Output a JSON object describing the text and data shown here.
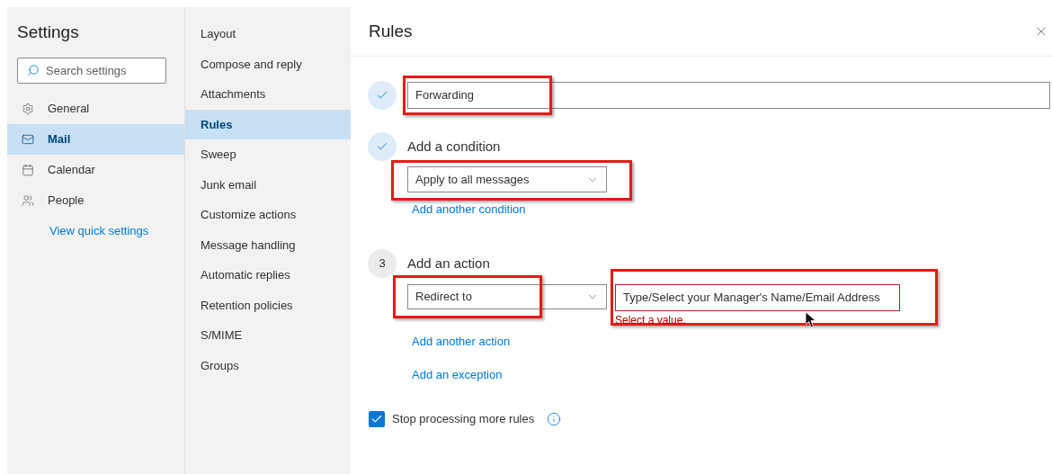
{
  "sidebar": {
    "title": "Settings",
    "search": {
      "placeholder": "Search settings"
    },
    "items": [
      {
        "label": "General",
        "selected": false
      },
      {
        "label": "Mail",
        "selected": true
      },
      {
        "label": "Calendar",
        "selected": false
      },
      {
        "label": "People",
        "selected": false
      }
    ],
    "link": "View quick settings"
  },
  "subnav": {
    "items": [
      {
        "label": "Layout",
        "selected": false
      },
      {
        "label": "Compose and reply",
        "selected": false
      },
      {
        "label": "Attachments",
        "selected": false
      },
      {
        "label": "Rules",
        "selected": true
      },
      {
        "label": "Sweep",
        "selected": false
      },
      {
        "label": "Junk email",
        "selected": false
      },
      {
        "label": "Customize actions",
        "selected": false
      },
      {
        "label": "Message handling",
        "selected": false
      },
      {
        "label": "Automatic replies",
        "selected": false
      },
      {
        "label": "Retention policies",
        "selected": false
      },
      {
        "label": "S/MIME",
        "selected": false
      },
      {
        "label": "Groups",
        "selected": false
      }
    ]
  },
  "panel": {
    "title": "Rules",
    "steps": [
      {
        "kind": "done",
        "controls": [
          {
            "kind": "text",
            "value": "Forwarding",
            "highlighted": true
          }
        ]
      },
      {
        "kind": "done",
        "title": "Add a condition",
        "controls": [
          {
            "kind": "dropdown",
            "value": "Apply to all messages",
            "highlighted": true
          }
        ],
        "links": [
          "Add another condition"
        ]
      },
      {
        "kind": "numbered",
        "number": "3",
        "title": "Add an action",
        "controls": [
          {
            "kind": "dropdown",
            "value": "Redirect to",
            "highlighted": true
          },
          {
            "kind": "text",
            "value": "Type/Select your Manager's Name/Email Address",
            "error": "Select a value.",
            "highlighted": true,
            "pointer": true
          }
        ],
        "links": [
          "Add another action",
          "Add an exception"
        ]
      }
    ],
    "stop_processing": {
      "label": "Stop processing more rules",
      "checked": true
    }
  }
}
